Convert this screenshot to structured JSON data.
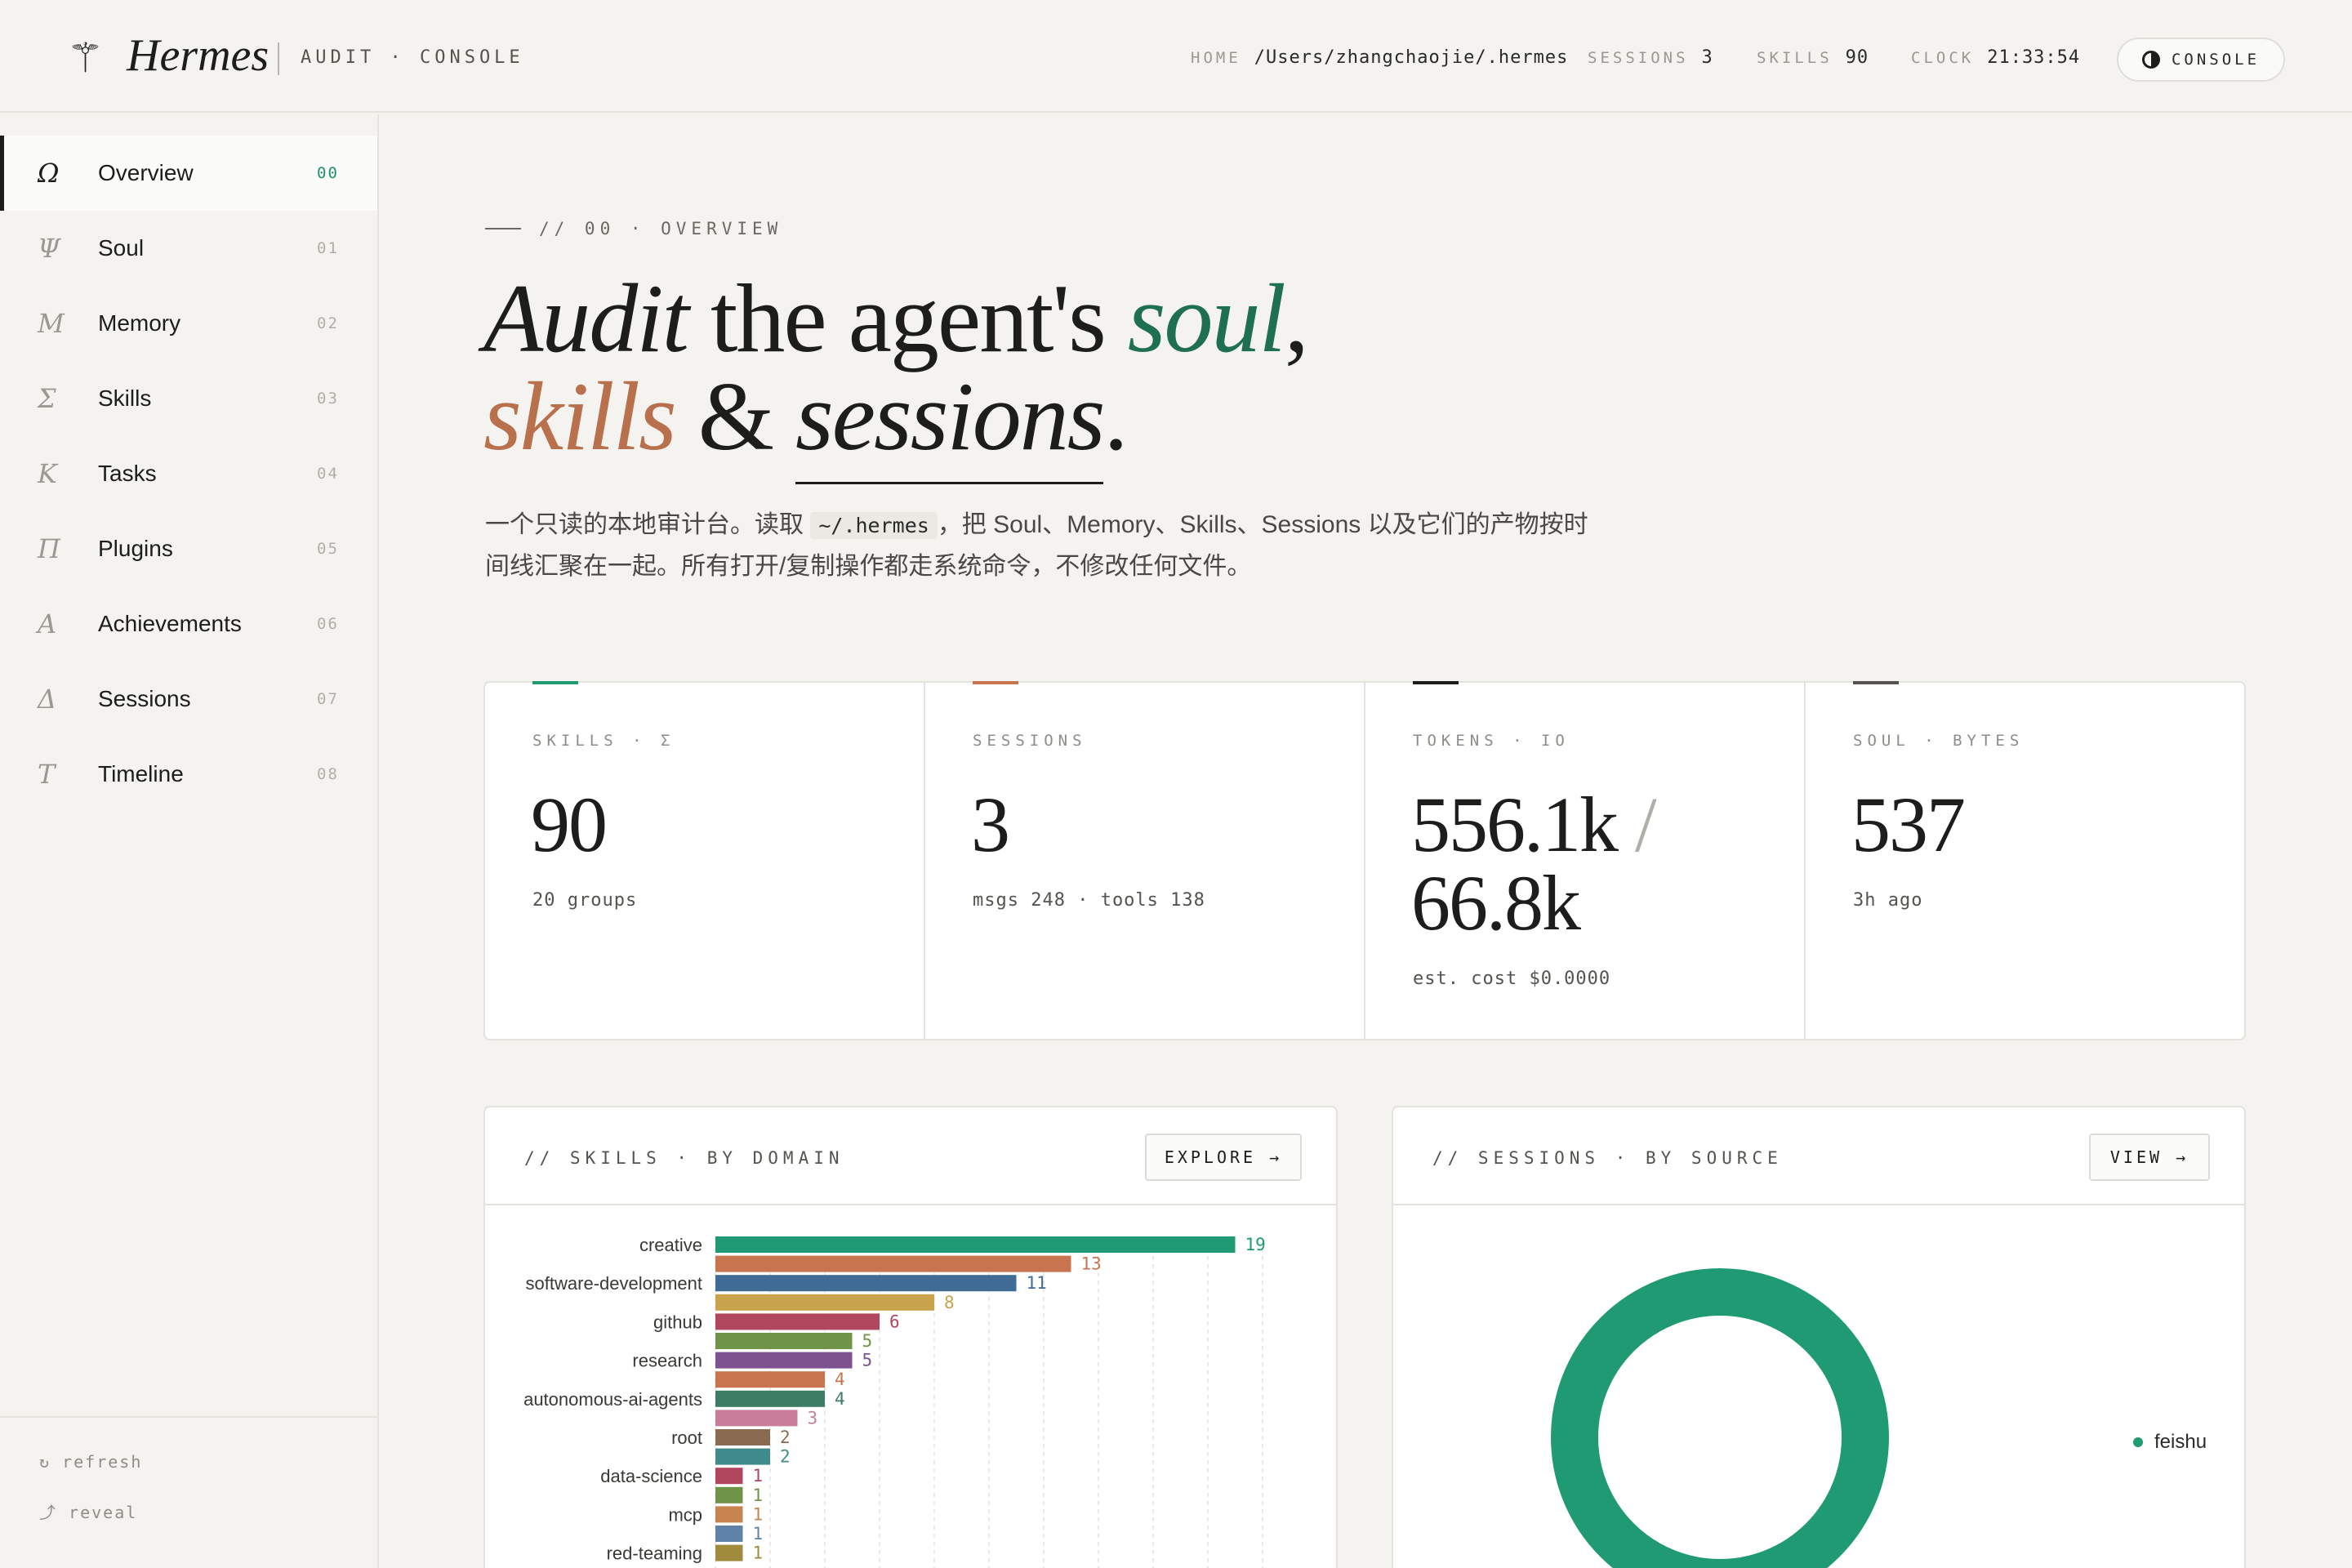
{
  "header": {
    "logo_glyph": "⚚",
    "brand": "Hermes",
    "subtitle": "AUDIT · CONSOLE",
    "home_label": "HOME",
    "home_value": "/Users/zhangchaojie/.hermes",
    "sessions_label": "SESSIONS",
    "sessions_value": "3",
    "skills_label": "SKILLS",
    "skills_value": "90",
    "clock_label": "CLOCK",
    "clock_value": "21:33:54",
    "console_label": "CONSOLE"
  },
  "sidebar": {
    "items": [
      {
        "glyph": "Ω",
        "label": "Overview",
        "num": "00"
      },
      {
        "glyph": "Ψ",
        "label": "Soul",
        "num": "01"
      },
      {
        "glyph": "M",
        "label": "Memory",
        "num": "02"
      },
      {
        "glyph": "Σ",
        "label": "Skills",
        "num": "03"
      },
      {
        "glyph": "K",
        "label": "Tasks",
        "num": "04"
      },
      {
        "glyph": "Π",
        "label": "Plugins",
        "num": "05"
      },
      {
        "glyph": "A",
        "label": "Achievements",
        "num": "06"
      },
      {
        "glyph": "Δ",
        "label": "Sessions",
        "num": "07"
      },
      {
        "glyph": "T",
        "label": "Timeline",
        "num": "08"
      }
    ],
    "refresh_label": "↻ refresh",
    "reveal_label": "⤴ reveal"
  },
  "hero": {
    "eyebrow": "// 00 · OVERVIEW",
    "line1_a": "Audit",
    "line1_b": " the agent's ",
    "line1_c": "soul",
    "line1_d": ",",
    "line2_a": "skills",
    "line2_b": " & ",
    "line2_c": "sessions",
    "line2_d": ".",
    "desc_1": "一个只读的本地审计台。读取 ",
    "desc_code": "~/.hermes",
    "desc_2": "，把 Soul、Memory、Skills、Sessions 以及它们的产物按时间线汇聚在一起。所有打开/复制操作都走系统命令，不修改任何文件。"
  },
  "kpis": [
    {
      "label": "SKILLS · Σ",
      "value": "90",
      "sub": "20 groups",
      "accent": "#1f9a72"
    },
    {
      "label": "SESSIONS",
      "value": "3",
      "sub": "msgs 248 · tools 138",
      "accent": "#c8744e"
    },
    {
      "label": "TOKENS · IO",
      "value_a": "556.1k",
      "value_sep": "/",
      "value_b": "66.8k",
      "sub": "est. cost $0.0000",
      "accent": "#1d1d1b"
    },
    {
      "label": "SOUL · BYTES",
      "value": "537",
      "sub": "3h ago",
      "accent": "#55534e"
    }
  ],
  "skills_panel": {
    "title": "// SKILLS · BY DOMAIN",
    "button": "EXPLORE →"
  },
  "sessions_panel": {
    "title": "// SESSIONS · BY SOURCE",
    "button": "VIEW →"
  },
  "chart_data": [
    {
      "type": "bar",
      "orientation": "horizontal",
      "categories": [
        "creative",
        "",
        "software-development",
        "",
        "github",
        "",
        "research",
        "",
        "autonomous-ai-agents",
        "",
        "root",
        "",
        "data-science",
        "",
        "mcp",
        "",
        "red-teaming"
      ],
      "values": [
        19,
        13,
        11,
        8,
        6,
        5,
        5,
        4,
        4,
        3,
        2,
        2,
        1,
        1,
        1,
        1,
        1
      ],
      "colors": [
        "#1f9a72",
        "#c8744e",
        "#3f6b94",
        "#c9a24c",
        "#b0475e",
        "#6f9448",
        "#7d528f",
        "#c8744e",
        "#3c7d64",
        "#c97d9b",
        "#8b6a52",
        "#3f8a8a",
        "#b0475e",
        "#6f9448",
        "#c8844e",
        "#5f82a8",
        "#a08a3c"
      ],
      "xlim": [
        0,
        20
      ],
      "grid": true
    },
    {
      "type": "pie",
      "variant": "donut",
      "labels": [
        "feishu"
      ],
      "values": [
        3
      ],
      "colors": [
        "#1f9a72"
      ],
      "legend": "right"
    }
  ]
}
